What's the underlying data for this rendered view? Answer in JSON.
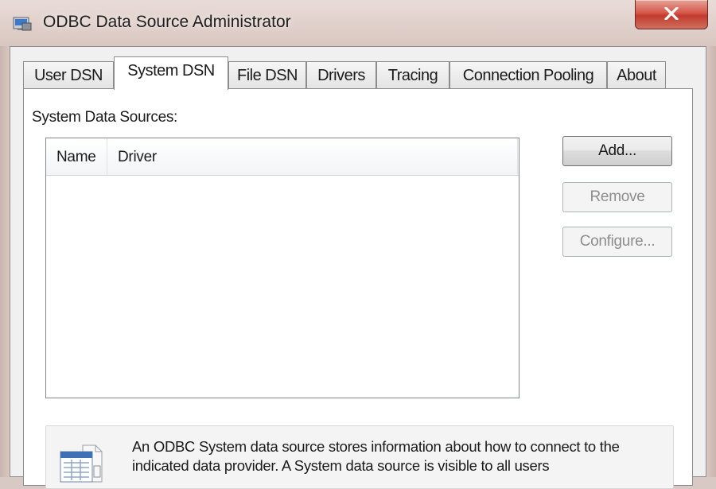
{
  "window": {
    "title": "ODBC Data Source Administrator",
    "close_glyph": "x"
  },
  "tabs": [
    {
      "label": "User DSN",
      "active": false
    },
    {
      "label": "System DSN",
      "active": true
    },
    {
      "label": "File DSN",
      "active": false
    },
    {
      "label": "Drivers",
      "active": false
    },
    {
      "label": "Tracing",
      "active": false
    },
    {
      "label": "Connection Pooling",
      "active": false
    },
    {
      "label": "About",
      "active": false
    }
  ],
  "panel": {
    "section_label": "System Data Sources:",
    "list": {
      "columns": [
        "Name",
        "Driver"
      ],
      "rows": []
    },
    "buttons": {
      "add": "Add...",
      "remove": "Remove",
      "configure": "Configure..."
    },
    "info_text": "An ODBC System data source stores information about how to connect to the indicated data provider.   A System data source is visible to all users"
  },
  "icons": {
    "app": "odbc-app-icon",
    "close": "close-icon",
    "info": "data-source-icon"
  },
  "colors": {
    "frame": "#d8c5bf",
    "close_button": "#d6574a",
    "panel": "#ffffff",
    "disabled_text": "#8d8d8d"
  }
}
